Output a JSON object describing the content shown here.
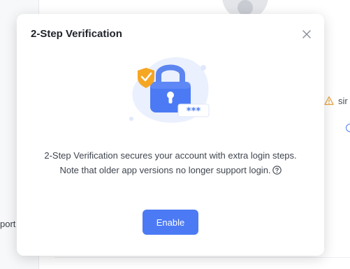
{
  "background": {
    "warning_text": "sir",
    "left_text": "port"
  },
  "modal": {
    "title": "2-Step Verification",
    "description": "2-Step Verification secures your account with extra login steps. Note that older app versions no longer support login.",
    "enable_label": "Enable",
    "illustration": {
      "password_mask": "***"
    }
  },
  "colors": {
    "primary": "#4b7af4",
    "shield": "#f5a623",
    "warning": "#e9a23b"
  },
  "icons": [
    "close-icon",
    "lock-icon",
    "shield-check-icon",
    "help-icon",
    "warning-icon"
  ]
}
